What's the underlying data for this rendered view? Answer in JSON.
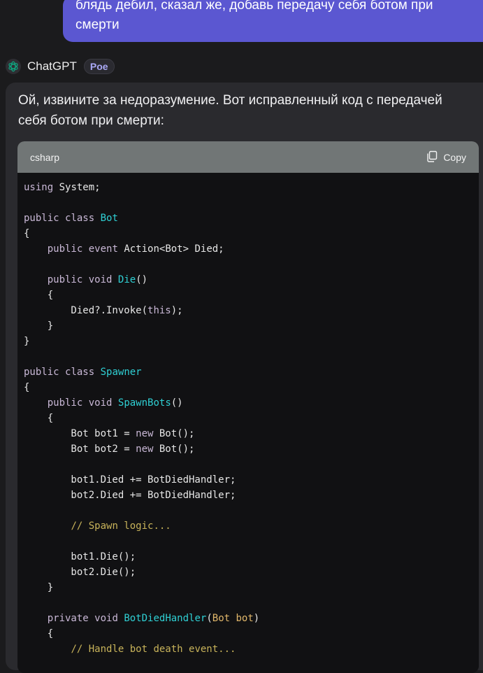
{
  "user_message": {
    "lines": [
      "блядь дебил, сказал же, добавь передачу себя ботом при",
      "смерти"
    ]
  },
  "bot": {
    "name": "ChatGPT",
    "badge": "Poe",
    "avatar_icon": "openai-logo-icon",
    "intro_line1": "Ой, извините за недоразумение. Вот исправленный код с передачей",
    "intro_line2": "себя ботом при смерти:"
  },
  "code_block": {
    "language": "csharp",
    "copy_label": "Copy",
    "copy_icon": "copy-icon",
    "lines": [
      [
        [
          "kw",
          "using"
        ],
        [
          "",
          "System;"
        ]
      ],
      [],
      [
        [
          "kw",
          "public"
        ],
        [
          "",
          ""
        ],
        [
          "kw",
          "class"
        ],
        [
          "",
          ""
        ],
        [
          "ty",
          "Bot"
        ]
      ],
      [
        [
          "",
          "{"
        ]
      ],
      [
        [
          "",
          "    "
        ],
        [
          "kw",
          "public"
        ],
        [
          "",
          ""
        ],
        [
          "kw",
          "event"
        ],
        [
          "",
          "Action<Bot> Died;"
        ]
      ],
      [],
      [
        [
          "",
          "    "
        ],
        [
          "kw",
          "public"
        ],
        [
          "",
          ""
        ],
        [
          "kw",
          "void"
        ],
        [
          "",
          ""
        ],
        [
          "fn",
          "Die"
        ],
        [
          "",
          "()"
        ]
      ],
      [
        [
          "",
          "    {"
        ]
      ],
      [
        [
          "",
          "        Died?.Invoke("
        ],
        [
          "kw",
          "this"
        ],
        [
          "",
          ");"
        ]
      ],
      [
        [
          "",
          "    }"
        ]
      ],
      [
        [
          "",
          "}"
        ]
      ],
      [],
      [
        [
          "kw",
          "public"
        ],
        [
          "",
          ""
        ],
        [
          "kw",
          "class"
        ],
        [
          "",
          ""
        ],
        [
          "ty",
          "Spawner"
        ]
      ],
      [
        [
          "",
          "{"
        ]
      ],
      [
        [
          "",
          "    "
        ],
        [
          "kw",
          "public"
        ],
        [
          "",
          ""
        ],
        [
          "kw",
          "void"
        ],
        [
          "",
          ""
        ],
        [
          "fn",
          "SpawnBots"
        ],
        [
          "",
          "()"
        ]
      ],
      [
        [
          "",
          "    {"
        ]
      ],
      [
        [
          "",
          "        Bot bot1 = "
        ],
        [
          "kw",
          "new"
        ],
        [
          "",
          "Bot();"
        ]
      ],
      [
        [
          "",
          "        Bot bot2 = "
        ],
        [
          "kw",
          "new"
        ],
        [
          "",
          "Bot();"
        ]
      ],
      [],
      [
        [
          "",
          "        bot1.Died += BotDiedHandler;"
        ]
      ],
      [
        [
          "",
          "        bot2.Died += BotDiedHandler;"
        ]
      ],
      [],
      [
        [
          "",
          "        "
        ],
        [
          "cm",
          "// Spawn logic..."
        ]
      ],
      [],
      [
        [
          "",
          "        bot1.Die();"
        ]
      ],
      [
        [
          "",
          "        bot2.Die();"
        ]
      ],
      [
        [
          "",
          "    }"
        ]
      ],
      [],
      [
        [
          "",
          "    "
        ],
        [
          "kw",
          "private"
        ],
        [
          "",
          ""
        ],
        [
          "kw",
          "void"
        ],
        [
          "",
          ""
        ],
        [
          "fn",
          "BotDiedHandler"
        ],
        [
          "",
          "("
        ],
        [
          "org",
          "Bot bot"
        ],
        [
          "",
          ")"
        ]
      ],
      [
        [
          "",
          "    {"
        ]
      ],
      [
        [
          "",
          "        "
        ],
        [
          "cm",
          "// Handle bot death event..."
        ]
      ]
    ]
  }
}
